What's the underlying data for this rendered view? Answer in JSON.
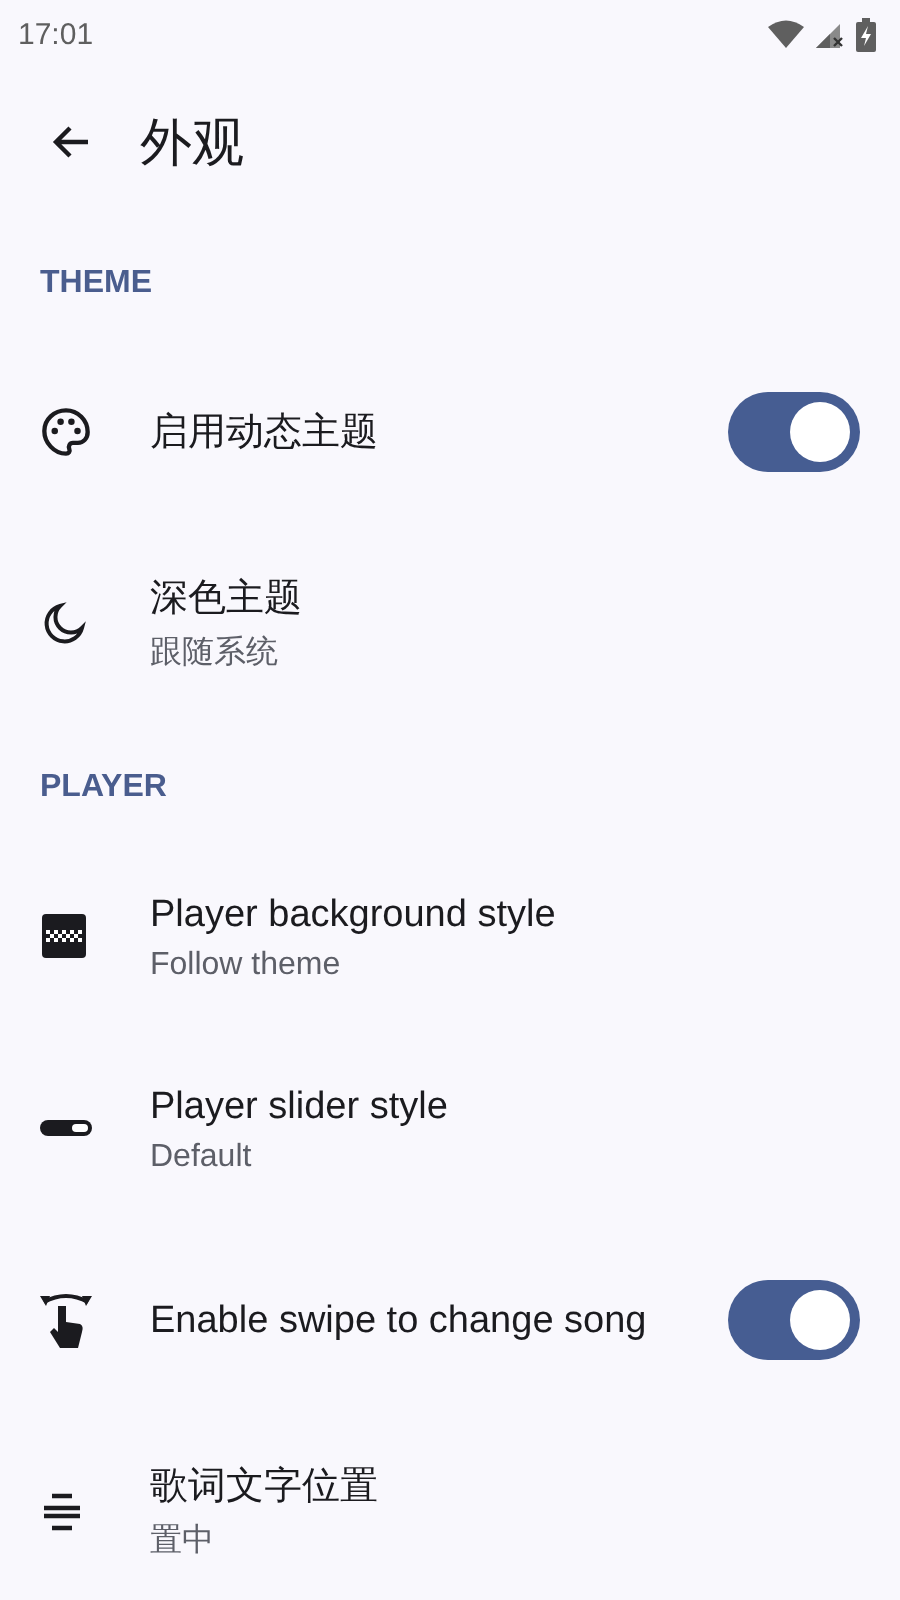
{
  "status_bar": {
    "time": "17:01"
  },
  "app_bar": {
    "title": "外观"
  },
  "sections": [
    {
      "title": "THEME",
      "items": [
        {
          "kind": "switch",
          "title": "启用动态主题",
          "on": true
        },
        {
          "kind": "value",
          "title": "深色主题",
          "value": "跟随系统"
        }
      ]
    },
    {
      "title": "PLAYER",
      "items": [
        {
          "kind": "value",
          "title": "Player background style",
          "value": "Follow theme"
        },
        {
          "kind": "value",
          "title": "Player slider style",
          "value": "Default"
        },
        {
          "kind": "switch",
          "title": "Enable swipe to change song",
          "on": true
        },
        {
          "kind": "value",
          "title": "歌词文字位置",
          "value": "置中"
        }
      ]
    }
  ]
}
